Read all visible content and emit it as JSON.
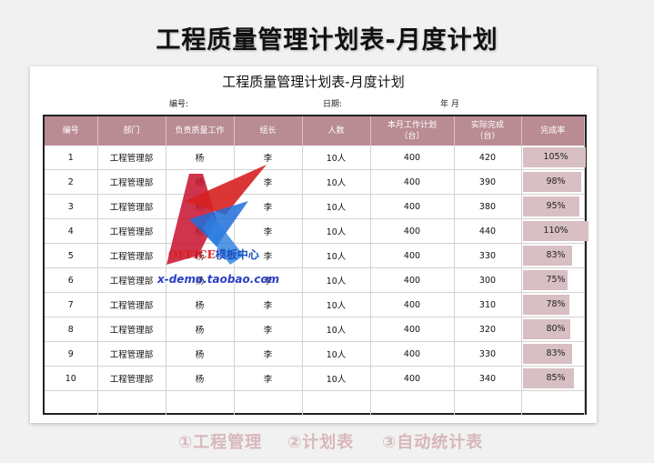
{
  "page_title": "工程质量管理计划表-月度计划",
  "sheet": {
    "title": "工程质量管理计划表-月度计划",
    "no_label": "编号:",
    "date_label": "日期:",
    "year_month_label": "年    月"
  },
  "table": {
    "headers": [
      "编号",
      "部门",
      "负责质量工作",
      "组长",
      "人数",
      "本月工作计划\n（台）",
      "实际完成\n（台）",
      "完成率"
    ],
    "rows": [
      [
        "1",
        "工程管理部",
        "杨",
        "李",
        "10人",
        "400",
        "420",
        "105%"
      ],
      [
        "2",
        "工程管理部",
        "杨",
        "李",
        "10人",
        "400",
        "390",
        "98%"
      ],
      [
        "3",
        "工程管理部",
        "杨",
        "李",
        "10人",
        "400",
        "380",
        "95%"
      ],
      [
        "4",
        "工程管理部",
        "杨",
        "李",
        "10人",
        "400",
        "440",
        "110%"
      ],
      [
        "5",
        "工程管理部",
        "杨",
        "李",
        "10人",
        "400",
        "330",
        "83%"
      ],
      [
        "6",
        "工程管理部",
        "杨",
        "李",
        "10人",
        "400",
        "300",
        "75%"
      ],
      [
        "7",
        "工程管理部",
        "杨",
        "李",
        "10人",
        "400",
        "310",
        "78%"
      ],
      [
        "8",
        "工程管理部",
        "杨",
        "李",
        "10人",
        "400",
        "320",
        "80%"
      ],
      [
        "9",
        "工程管理部",
        "杨",
        "李",
        "10人",
        "400",
        "330",
        "83%"
      ],
      [
        "10",
        "工程管理部",
        "杨",
        "李",
        "10人",
        "400",
        "340",
        "85%"
      ]
    ],
    "rate_fractions": [
      1.05,
      0.98,
      0.95,
      1.1,
      0.83,
      0.75,
      0.78,
      0.8,
      0.83,
      0.85
    ]
  },
  "watermark": {
    "office": "OFFICE",
    "office_suffix": "模板中心",
    "url": "x-demo.taobao.com"
  },
  "footer": {
    "item1": "①工程管理",
    "item2": "②计划表",
    "item3": "③自动统计表"
  },
  "colors": {
    "header_bg": "#b98b93",
    "rate_bar": "#d8bfc3",
    "footer_text": "#d8b7bb"
  }
}
